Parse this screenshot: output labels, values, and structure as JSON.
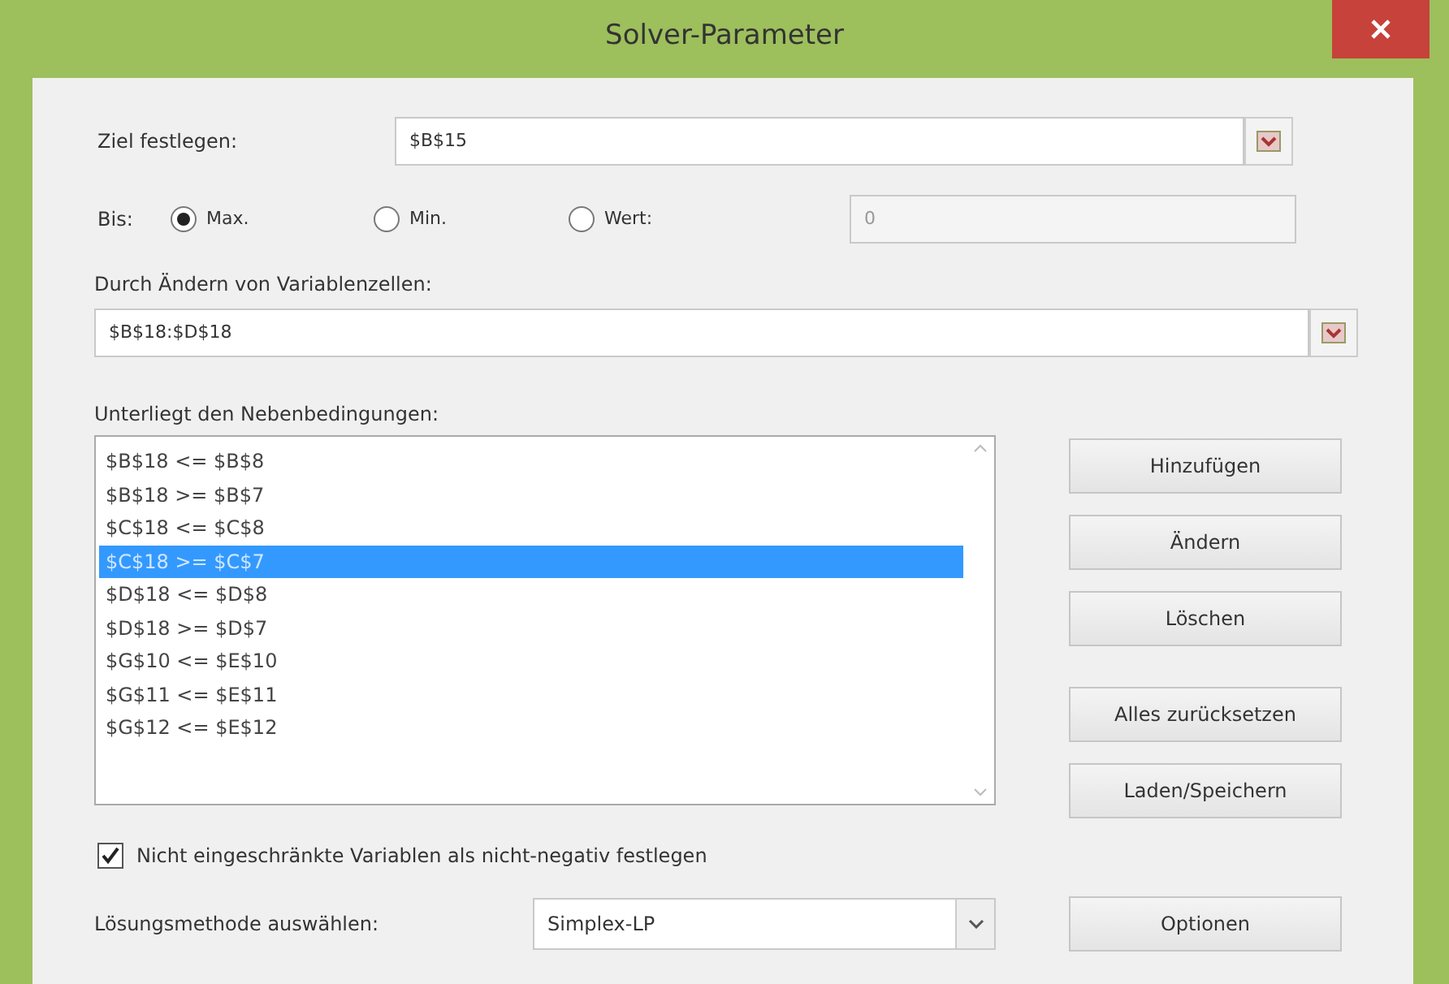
{
  "window": {
    "title": "Solver-Parameter"
  },
  "objective": {
    "label": "Ziel festlegen:",
    "value": "$B$15"
  },
  "to": {
    "label": "Bis:",
    "options": [
      {
        "label": "Max.",
        "selected": true
      },
      {
        "label": "Min.",
        "selected": false
      },
      {
        "label": "Wert:",
        "selected": false
      }
    ],
    "value_field": {
      "value": "0",
      "disabled": true
    }
  },
  "variables": {
    "label": "Durch Ändern von Variablenzellen:",
    "value": "$B$18:$D$18"
  },
  "constraints": {
    "label": "Unterliegt den Nebenbedingungen:",
    "items": [
      {
        "text": "$B$18 <= $B$8",
        "selected": false
      },
      {
        "text": "$B$18 >= $B$7",
        "selected": false
      },
      {
        "text": "$C$18 <= $C$8",
        "selected": false
      },
      {
        "text": "$C$18 >= $C$7",
        "selected": true
      },
      {
        "text": "$D$18 <= $D$8",
        "selected": false
      },
      {
        "text": "$D$18 >= $D$7",
        "selected": false
      },
      {
        "text": "$G$10 <= $E$10",
        "selected": false
      },
      {
        "text": "$G$11 <= $E$11",
        "selected": false
      },
      {
        "text": "$G$12 <= $E$12",
        "selected": false
      }
    ],
    "edit_buttons": [
      "Hinzufügen",
      "Ändern",
      "Löschen"
    ],
    "reset_buttons": [
      "Alles zurücksetzen",
      "Laden/Speichern"
    ]
  },
  "nonnegative": {
    "label": "Nicht eingeschränkte Variablen als nicht-negativ festlegen",
    "checked": true
  },
  "method": {
    "label": "Lösungsmethode auswählen:",
    "value": "Simplex-LP"
  },
  "options_button": {
    "label": "Optionen"
  }
}
